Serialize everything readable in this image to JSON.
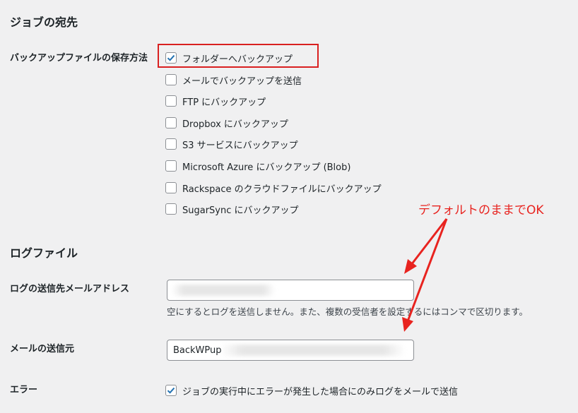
{
  "sections": {
    "destinations_title": "ジョブの宛先",
    "log_title": "ログファイル"
  },
  "destinations": {
    "label": "バックアップファイルの保存方法",
    "options": [
      {
        "label": "フォルダーへバックアップ",
        "checked": true
      },
      {
        "label": "メールでバックアップを送信",
        "checked": false
      },
      {
        "label": "FTP にバックアップ",
        "checked": false
      },
      {
        "label": "Dropbox にバックアップ",
        "checked": false
      },
      {
        "label": "S3 サービスにバックアップ",
        "checked": false
      },
      {
        "label": "Microsoft Azure にバックアップ (Blob)",
        "checked": false
      },
      {
        "label": "Rackspace のクラウドファイルにバックアップ",
        "checked": false
      },
      {
        "label": "SugarSync にバックアップ",
        "checked": false
      }
    ]
  },
  "log": {
    "email_label": "ログの送信先メールアドレス",
    "email_value": "",
    "email_hint": "空にするとログを送信しません。また、複数の受信者を設定するにはコンマで区切ります。",
    "sender_label": "メールの送信元",
    "sender_value": "BackWPup",
    "error_label": "エラー",
    "error_option": {
      "label": "ジョブの実行中にエラーが発生した場合にのみログをメールで送信",
      "checked": true
    }
  },
  "annotation": {
    "text": "デフォルトのままでOK",
    "color": "#e8231f"
  },
  "colors": {
    "accent": "#2271b1",
    "highlight": "#d92020",
    "background": "#f0f0f1"
  }
}
